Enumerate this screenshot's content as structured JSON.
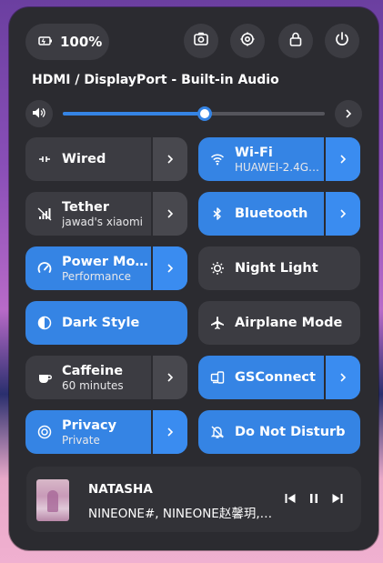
{
  "topbar": {
    "battery_percent": "100%",
    "buttons": [
      "screenshot-icon",
      "settings-icon",
      "lock-icon",
      "power-icon"
    ]
  },
  "audio": {
    "device": "HDMI / DisplayPort - Built-in Audio",
    "volume": 0.54
  },
  "tiles": [
    {
      "title": "Wired",
      "sub": "",
      "on": false,
      "arrow": true,
      "icon": "wired-icon"
    },
    {
      "title": "Wi-Fi",
      "sub": "HUAWEI-2.4G…",
      "on": true,
      "arrow": true,
      "icon": "wifi-icon"
    },
    {
      "title": "Tether",
      "sub": "jawad's xiaomi",
      "on": false,
      "arrow": true,
      "icon": "tether-icon"
    },
    {
      "title": "Bluetooth",
      "sub": "",
      "on": true,
      "arrow": true,
      "icon": "bluetooth-icon"
    },
    {
      "title": "Power Mo…",
      "sub": "Performance",
      "on": true,
      "arrow": true,
      "icon": "power-mode-icon"
    },
    {
      "title": "Night Light",
      "sub": "",
      "on": false,
      "arrow": false,
      "icon": "night-light-icon"
    },
    {
      "title": "Dark Style",
      "sub": "",
      "on": true,
      "arrow": false,
      "icon": "dark-style-icon"
    },
    {
      "title": "Airplane Mode",
      "sub": "",
      "on": false,
      "arrow": false,
      "icon": "airplane-icon"
    },
    {
      "title": "Caffeine",
      "sub": "60 minutes",
      "on": false,
      "arrow": true,
      "icon": "caffeine-icon"
    },
    {
      "title": "GSConnect",
      "sub": "",
      "on": true,
      "arrow": true,
      "icon": "gsconnect-icon"
    },
    {
      "title": "Privacy",
      "sub": "Private",
      "on": true,
      "arrow": true,
      "icon": "privacy-icon"
    },
    {
      "title": "Do Not Disturb",
      "sub": "",
      "on": true,
      "arrow": false,
      "icon": "do-not-disturb-icon"
    }
  ],
  "media": {
    "song": "NATASHA",
    "artist": "NINEONE#, NINEONE赵馨玥, …"
  },
  "colors": {
    "accent": "#3584e4",
    "tile_off": "#3c3c42",
    "panel": "#2b2b30"
  }
}
